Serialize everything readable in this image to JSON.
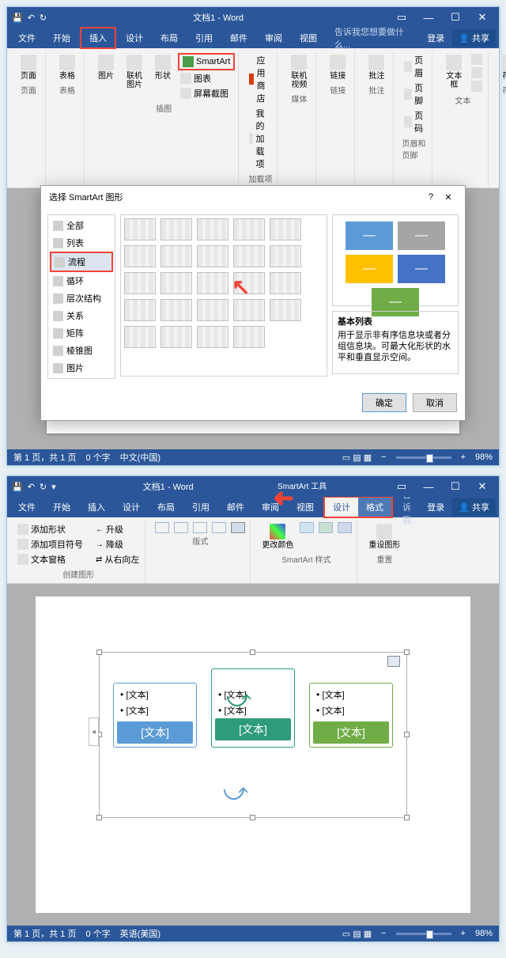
{
  "window1": {
    "title": "文档1 - Word",
    "tabs": [
      "文件",
      "开始",
      "插入",
      "设计",
      "布局",
      "引用",
      "邮件",
      "审阅",
      "视图"
    ],
    "tell_me": "告诉我您想要做什么...",
    "login": "登录",
    "share": "共享",
    "ribbon": {
      "page_group": "页面",
      "table_group": "表格",
      "illus_group": "插图",
      "addin_group": "加载项",
      "media_group": "媒体",
      "link_group": "链接",
      "page": "页面",
      "table": "表格",
      "pic": "图片",
      "online_pic": "联机图片",
      "shape": "形状",
      "smartart": "SmartArt",
      "chart": "图表",
      "screenshot": "屏幕截图",
      "store": "应用商店",
      "myaddin": "我的加载项",
      "online_video": "联机视频",
      "link": "链接",
      "comment": "批注",
      "comment_group": "批注",
      "header": "页眉",
      "footer": "页脚",
      "pagenum": "页码",
      "hf_group": "页眉和页脚",
      "textbox": "文本框",
      "text_group": "文本",
      "symbol": "符号",
      "symbol_group": "符号"
    },
    "status": {
      "page": "第 1 页，共 1 页",
      "words": "0 个字",
      "lang": "中文(中国)",
      "zoom": "98%"
    }
  },
  "dialog": {
    "title": "选择 SmartArt 图形",
    "categories": [
      "全部",
      "列表",
      "流程",
      "循环",
      "层次结构",
      "关系",
      "矩阵",
      "棱锥图",
      "图片"
    ],
    "preview_title": "基本列表",
    "preview_desc": "用于显示非有序信息块或者分组信息块。可最大化形状的水平和垂直显示空间。",
    "ok": "确定",
    "cancel": "取消"
  },
  "window2": {
    "title": "文档1 - Word",
    "tool_title": "SmartArt 工具",
    "tabs": [
      "文件",
      "开始",
      "插入",
      "设计",
      "布局",
      "引用",
      "邮件",
      "审阅",
      "视图"
    ],
    "tool_tabs": [
      "设计",
      "格式"
    ],
    "tell_me": "告诉我...",
    "login": "登录",
    "share": "共享",
    "ribbon": {
      "add_shape": "添加形状",
      "add_bullet": "添加项目符号",
      "text_pane": "文本窗格",
      "promote": "升级",
      "demote": "降级",
      "rtl": "从右向左",
      "create_group": "创建图形",
      "layout_group": "版式",
      "style_group": "SmartArt 样式",
      "reset_group": "重置",
      "change_color": "更改颜色",
      "reset": "重设图形"
    },
    "canvas": {
      "text_placeholder": "[文本]"
    },
    "status": {
      "page": "第 1 页，共 1 页",
      "words": "0 个字",
      "lang": "英语(美国)",
      "zoom": "98%"
    }
  }
}
